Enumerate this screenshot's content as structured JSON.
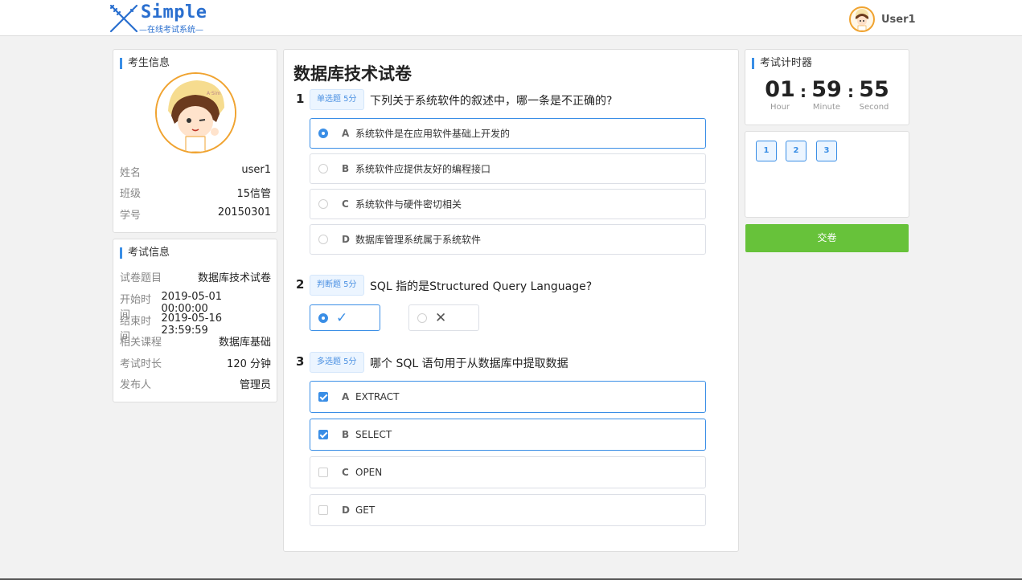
{
  "header": {
    "logo_text": "Simple",
    "logo_sub": "—在线考试系统—",
    "user_name": "User1",
    "avatar_icon": "cartoon-avatar-icon"
  },
  "student": {
    "title": "考生信息",
    "rows": [
      {
        "label": "姓名",
        "value": "user1"
      },
      {
        "label": "班级",
        "value": "15信管"
      },
      {
        "label": "学号",
        "value": "20150301"
      }
    ]
  },
  "exam": {
    "title": "考试信息",
    "rows": [
      {
        "label": "试卷题目",
        "value": "数据库技术试卷"
      },
      {
        "label": "开始时间",
        "value": "2019-05-01 00:00:00"
      },
      {
        "label": "结束时间",
        "value": "2019-05-16 23:59:59"
      },
      {
        "label": "相关课程",
        "value": "数据库基础"
      },
      {
        "label": "考试时长",
        "value": "120 分钟"
      },
      {
        "label": "发布人",
        "value": "管理员"
      }
    ]
  },
  "paper": {
    "title": "数据库技术试卷",
    "questions": [
      {
        "num": "1",
        "tag": "单选题 5分",
        "text": "下列关于系统软件的叙述中，哪一条是不正确的?",
        "options": [
          {
            "letter": "A",
            "text": "系统软件是在应用软件基础上开发的",
            "selected": true
          },
          {
            "letter": "B",
            "text": "系统软件应提供友好的编程接口",
            "selected": false
          },
          {
            "letter": "C",
            "text": "系统软件与硬件密切相关",
            "selected": false
          },
          {
            "letter": "D",
            "text": "数据库管理系统属于系统软件",
            "selected": false
          }
        ]
      },
      {
        "num": "2",
        "tag": "判断题 5分",
        "text": "SQL 指的是Structured Query Language?",
        "options": [
          {
            "symbol": "✓",
            "selected": true
          },
          {
            "symbol": "✕",
            "selected": false
          }
        ]
      },
      {
        "num": "3",
        "tag": "多选题 5分",
        "text": "哪个 SQL 语句用于从数据库中提取数据",
        "options": [
          {
            "letter": "A",
            "text": "EXTRACT",
            "selected": true
          },
          {
            "letter": "B",
            "text": "SELECT",
            "selected": true
          },
          {
            "letter": "C",
            "text": "OPEN",
            "selected": false
          },
          {
            "letter": "D",
            "text": "GET",
            "selected": false
          }
        ]
      }
    ]
  },
  "timer": {
    "title": "考试计时器",
    "hour": "01",
    "minute": "59",
    "second": "55",
    "hour_label": "Hour",
    "minute_label": "Minute",
    "second_label": "Second",
    "colon": ":"
  },
  "nav": [
    "1",
    "2",
    "3"
  ],
  "submit_label": "交卷",
  "colors": {
    "accent": "#3a8ee6",
    "submit": "#67c23a",
    "avatar_border": "#f0a330"
  }
}
